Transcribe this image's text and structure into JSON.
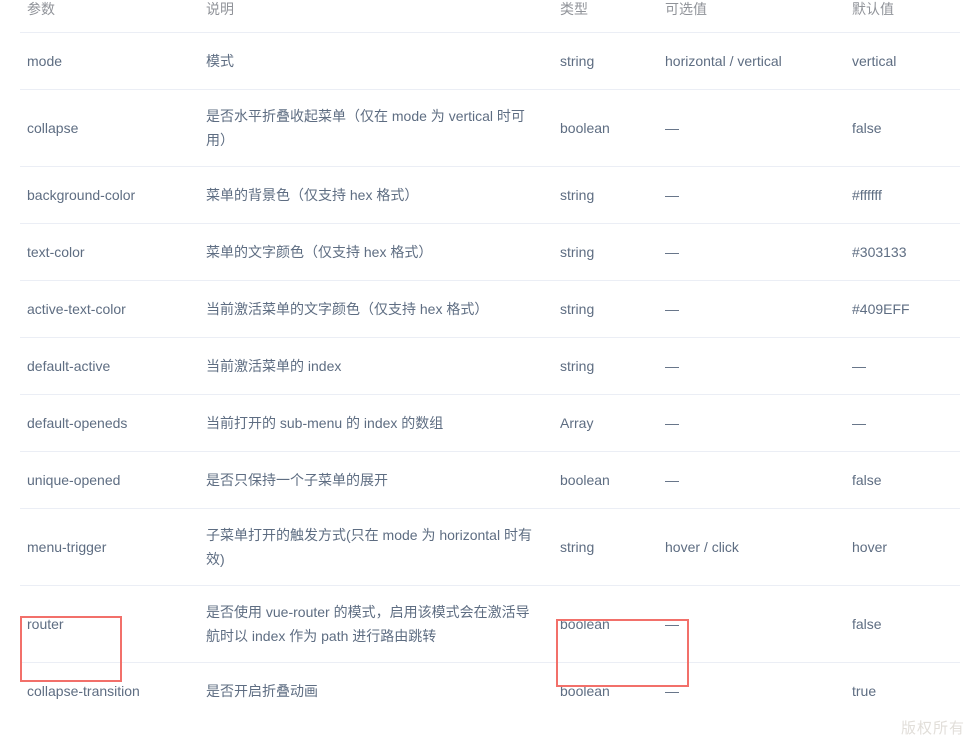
{
  "table": {
    "headers": {
      "param": "参数",
      "desc": "说明",
      "type": "类型",
      "options": "可选值",
      "default": "默认值"
    },
    "rows": [
      {
        "param": "mode",
        "desc": "模式",
        "type": "string",
        "options": "horizontal / vertical",
        "default": "vertical"
      },
      {
        "param": "collapse",
        "desc": "是否水平折叠收起菜单（仅在 mode 为 vertical 时可用）",
        "type": "boolean",
        "options": "—",
        "default": "false"
      },
      {
        "param": "background-color",
        "desc": "菜单的背景色（仅支持 hex 格式）",
        "type": "string",
        "options": "—",
        "default": "#ffffff"
      },
      {
        "param": "text-color",
        "desc": "菜单的文字颜色（仅支持 hex 格式）",
        "type": "string",
        "options": "—",
        "default": "#303133"
      },
      {
        "param": "active-text-color",
        "desc": "当前激活菜单的文字颜色（仅支持 hex 格式）",
        "type": "string",
        "options": "—",
        "default": "#409EFF"
      },
      {
        "param": "default-active",
        "desc": "当前激活菜单的 index",
        "type": "string",
        "options": "—",
        "default": "—"
      },
      {
        "param": "default-openeds",
        "desc": "当前打开的 sub-menu 的 index 的数组",
        "type": "Array",
        "options": "—",
        "default": "—"
      },
      {
        "param": "unique-opened",
        "desc": "是否只保持一个子菜单的展开",
        "type": "boolean",
        "options": "—",
        "default": "false"
      },
      {
        "param": "menu-trigger",
        "desc": "子菜单打开的触发方式(只在 mode 为 horizontal 时有效)",
        "type": "string",
        "options": "hover / click",
        "default": "hover"
      },
      {
        "param": "router",
        "desc": "是否使用 vue-router 的模式，启用该模式会在激活导航时以 index 作为 path 进行路由跳转",
        "type": "boolean",
        "options": "—",
        "default": "false"
      },
      {
        "param": "collapse-transition",
        "desc": "是否开启折叠动画",
        "type": "boolean",
        "options": "—",
        "default": "true"
      }
    ]
  },
  "annotations": {
    "router_cell_highlight": "router",
    "type_cell_highlight": "boolean",
    "box_color": "#f2706a"
  },
  "watermark": {
    "text": "版权所有"
  }
}
